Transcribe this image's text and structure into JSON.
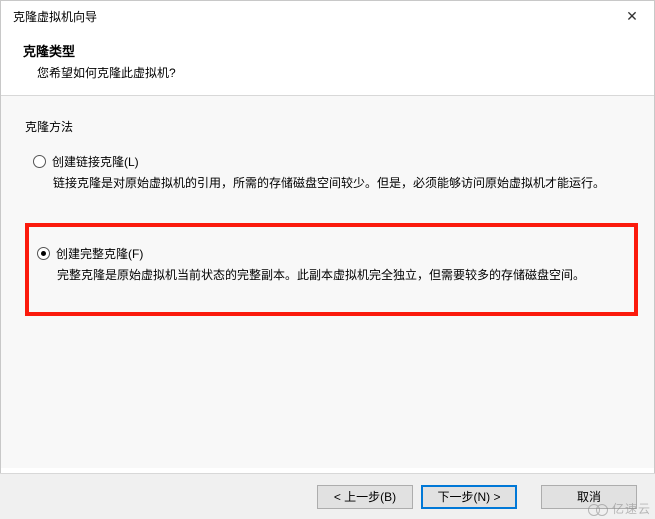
{
  "window": {
    "title": "克隆虚拟机向导"
  },
  "header": {
    "title": "克隆类型",
    "subtitle": "您希望如何克隆此虚拟机?"
  },
  "section_label": "克隆方法",
  "options": {
    "linked": {
      "label": "创建链接克隆(L)",
      "desc": "链接克隆是对原始虚拟机的引用，所需的存储磁盘空间较少。但是，必须能够访问原始虚拟机才能运行。",
      "selected": false
    },
    "full": {
      "label": "创建完整克隆(F)",
      "desc": "完整克隆是原始虚拟机当前状态的完整副本。此副本虚拟机完全独立，但需要较多的存储磁盘空间。",
      "selected": true
    }
  },
  "buttons": {
    "back": "< 上一步(B)",
    "next": "下一步(N) >",
    "cancel": "取消"
  },
  "watermark": "亿速云"
}
